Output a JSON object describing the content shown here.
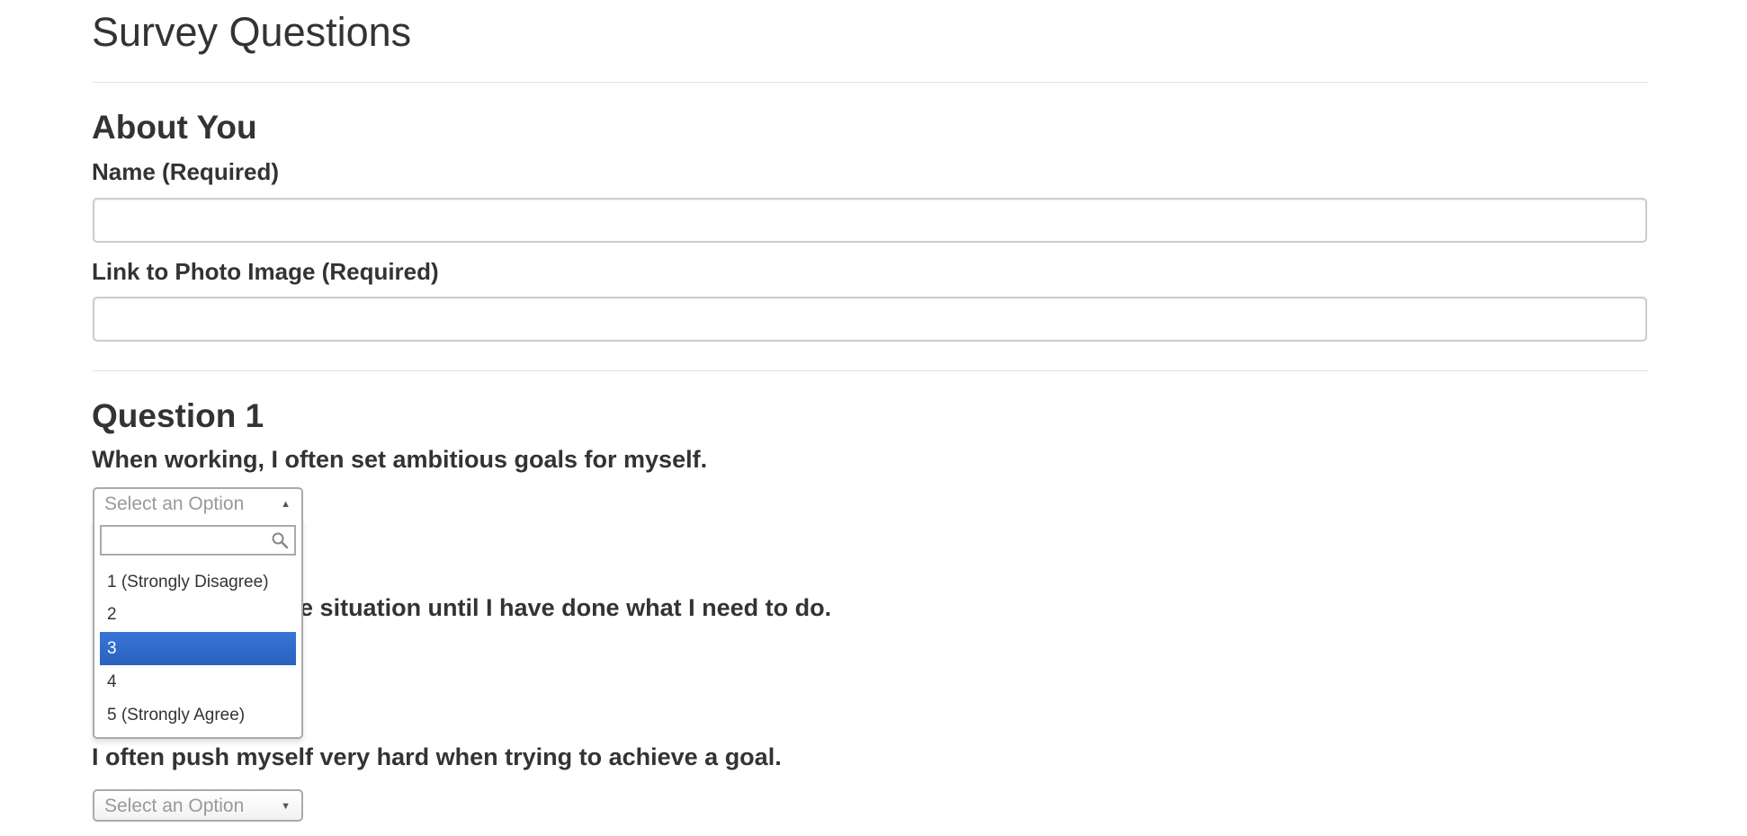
{
  "page": {
    "title": "Survey Questions"
  },
  "about": {
    "heading": "About You",
    "name_label": "Name (Required)",
    "name_value": "",
    "photo_label": "Link to Photo Image (Required)",
    "photo_value": ""
  },
  "question1": {
    "heading": "Question 1",
    "text": "When working, I often set ambitious goals for myself.",
    "select_placeholder": "Select an Option",
    "dropdown_open": true,
    "search_value": "",
    "options": [
      "1 (Strongly Disagree)",
      "2",
      "3",
      "4",
      "5 (Strongly Agree)"
    ],
    "highlighted_option": "3"
  },
  "question2": {
    "text_visible": "ed, I will stay in the situation until I have done what I need to do."
  },
  "question3": {
    "text": "I often push myself very hard when trying to achieve a goal.",
    "select_placeholder": "Select an Option"
  },
  "colors": {
    "highlight": "#3875d7",
    "text": "#333333",
    "border": "#aaaaaa",
    "placeholder": "#999999"
  }
}
